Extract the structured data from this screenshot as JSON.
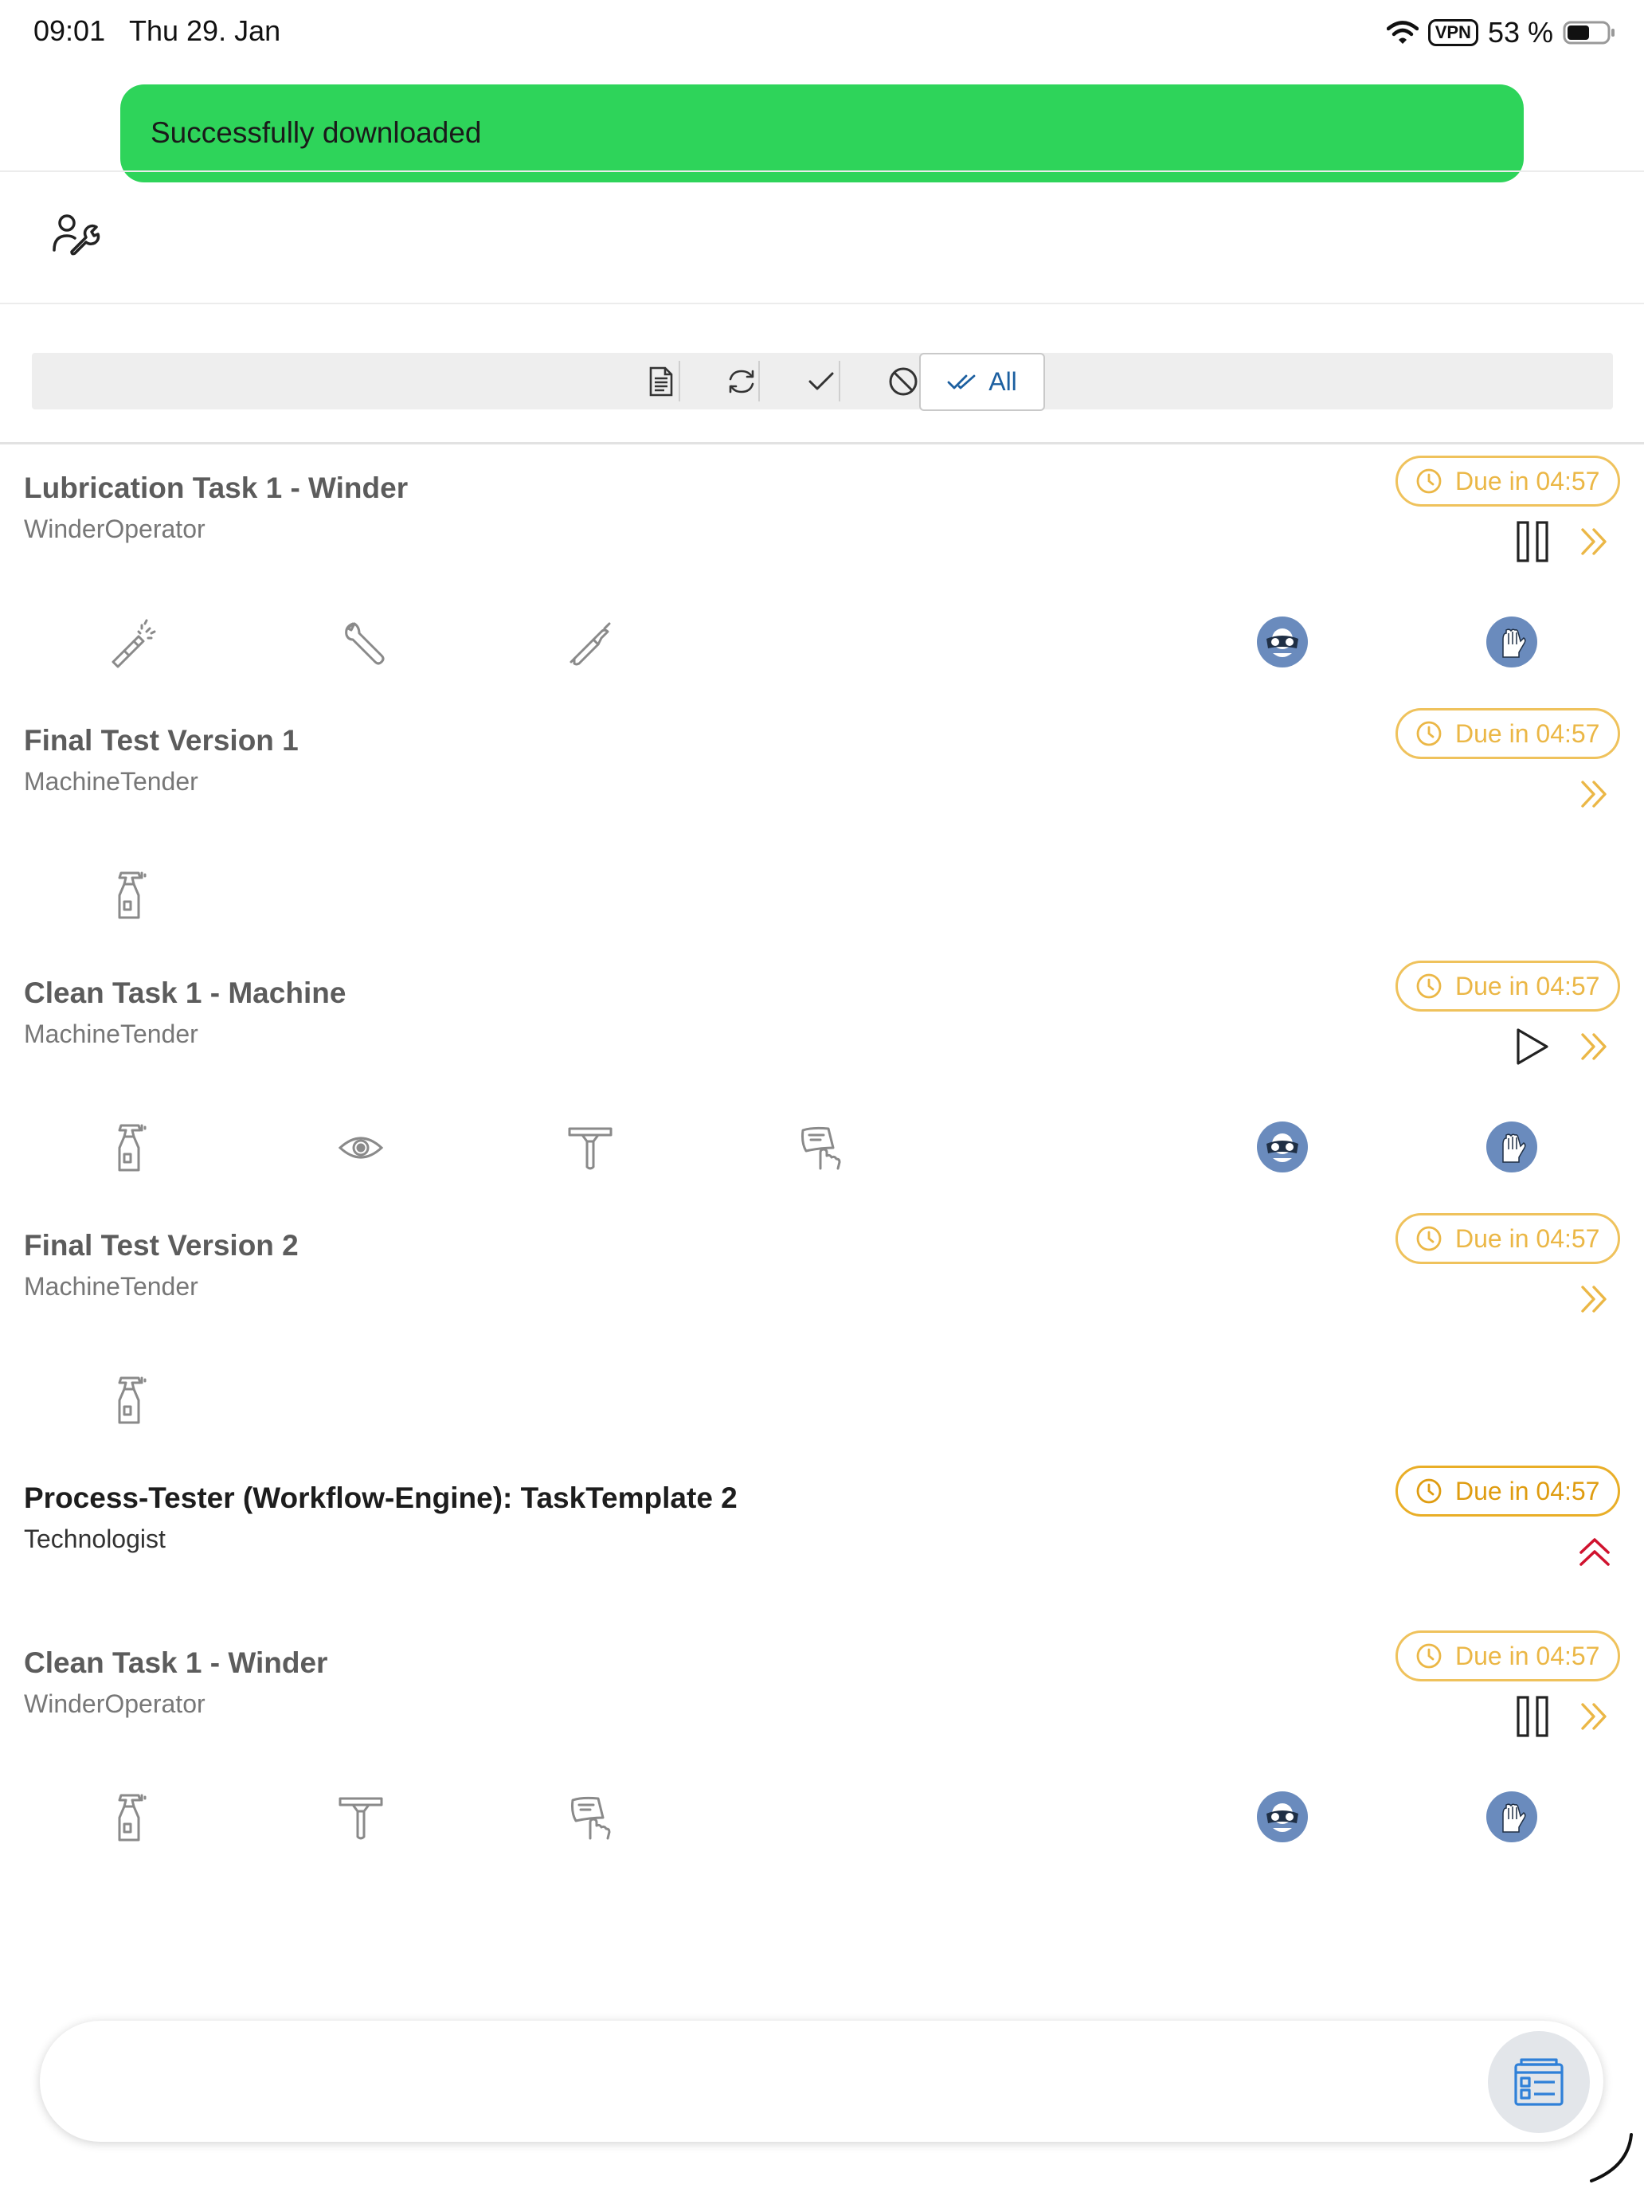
{
  "status_bar": {
    "time": "09:01",
    "date": "Thu 29. Jan",
    "vpn": "VPN",
    "battery": "53 %"
  },
  "toast": {
    "message": "Successfully downloaded",
    "color": "#2ed45a"
  },
  "header": {
    "icon": "user-wrench-icon"
  },
  "filter_bar": {
    "buttons": [
      {
        "icon": "document-list-icon"
      },
      {
        "icon": "sync-icon"
      },
      {
        "icon": "checkmark-icon"
      },
      {
        "icon": "blocked-icon"
      }
    ],
    "all_label": "All",
    "all_icon": "double-check-icon",
    "selected": "All"
  },
  "tasks": [
    {
      "title": "Lubrication Task 1 - Winder",
      "role": "WinderOperator",
      "due": "Due in 04:57",
      "actions": [
        "pause-icon",
        "chevron-double-right-icon"
      ],
      "tools": [
        "spray-nozzle-icon",
        "wrench-icon",
        "grease-gun-icon"
      ],
      "ppe": [
        "safety-goggles-icon",
        "safety-gloves-icon"
      ]
    },
    {
      "title": "Final Test Version 1",
      "role": "MachineTender",
      "due": "Due in 04:57",
      "actions": [
        "chevron-double-right-icon"
      ],
      "tools": [
        "spray-bottle-icon"
      ],
      "ppe": []
    },
    {
      "title": "Clean Task 1 - Machine",
      "role": "MachineTender",
      "due": "Due in 04:57",
      "actions": [
        "play-icon",
        "chevron-double-right-icon"
      ],
      "tools": [
        "spray-bottle-icon",
        "eye-icon",
        "scraper-icon",
        "cleaning-cloth-icon"
      ],
      "ppe": [
        "safety-goggles-icon",
        "safety-gloves-icon"
      ]
    },
    {
      "title": "Final Test Version 2",
      "role": "MachineTender",
      "due": "Due in 04:57",
      "actions": [
        "chevron-double-right-icon"
      ],
      "tools": [
        "spray-bottle-icon"
      ],
      "ppe": []
    },
    {
      "title": "Process-Tester (Workflow-Engine): TaskTemplate 2",
      "role": "Technologist",
      "due": "Due in 04:57",
      "actions": [
        "chevron-double-up-icon"
      ],
      "tools": [],
      "ppe": []
    },
    {
      "title": "Clean Task 1 - Winder",
      "role": "WinderOperator",
      "due": "Due in 04:57",
      "actions": [
        "pause-icon",
        "chevron-double-right-icon"
      ],
      "tools": [
        "spray-bottle-icon",
        "scraper-icon",
        "cleaning-cloth-icon"
      ],
      "ppe": [
        "safety-goggles-icon",
        "safety-gloves-icon"
      ]
    }
  ],
  "bottom_bar": {
    "fab_icon": "task-board-icon"
  },
  "colors": {
    "due_accent": "#ebb746",
    "priority_red": "#d0122e",
    "ppe_blue": "#6a8bbd",
    "link_blue": "#1c5fa0"
  }
}
